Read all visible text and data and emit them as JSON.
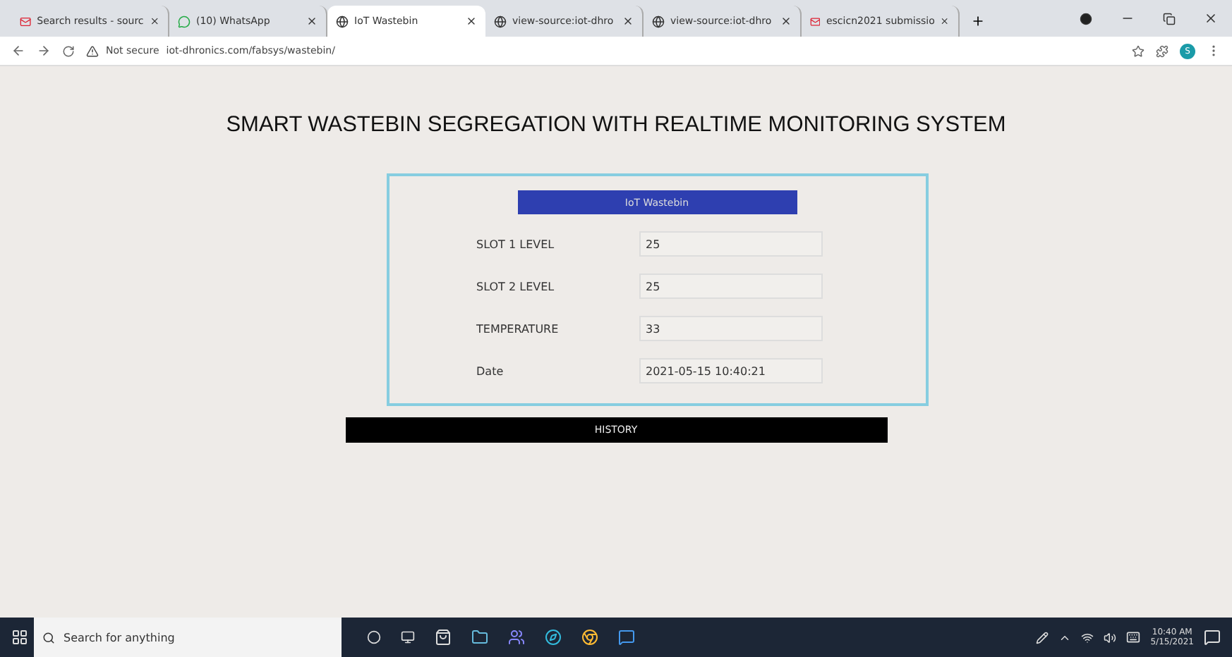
{
  "browser": {
    "tabs": [
      {
        "label": "Search results - sourc",
        "kind": "mail",
        "selected": false
      },
      {
        "label": "(10) WhatsApp",
        "kind": "chat",
        "selected": false
      },
      {
        "label": "IoT Wastebin",
        "kind": "globe",
        "selected": true
      },
      {
        "label": "view-source:iot-dhro",
        "kind": "globe",
        "selected": false
      },
      {
        "label": "view-source:iot-dhro",
        "kind": "globe",
        "selected": false
      },
      {
        "label": "escicn2021 submissio",
        "kind": "mail",
        "selected": false
      }
    ],
    "security": "Not secure",
    "url": "iot-dhronics.com/fabsys/wastebin/",
    "profile": "S"
  },
  "page": {
    "title": "SMART WASTEBIN SEGREGATION WITH REALTIME MONITORING SYSTEM",
    "card_header": "IoT Wastebin",
    "fields": [
      {
        "label": "SLOT 1 LEVEL",
        "value": "25"
      },
      {
        "label": "SLOT 2 LEVEL",
        "value": "25"
      },
      {
        "label": "TEMPERATURE",
        "value": "33"
      },
      {
        "label": "Date",
        "value": "2021-05-15 10:40:21"
      }
    ],
    "history_button": "HISTORY"
  },
  "taskbar": {
    "search_placeholder": "Search for anything",
    "time": "10:40 AM",
    "date": "5/15/2021"
  }
}
